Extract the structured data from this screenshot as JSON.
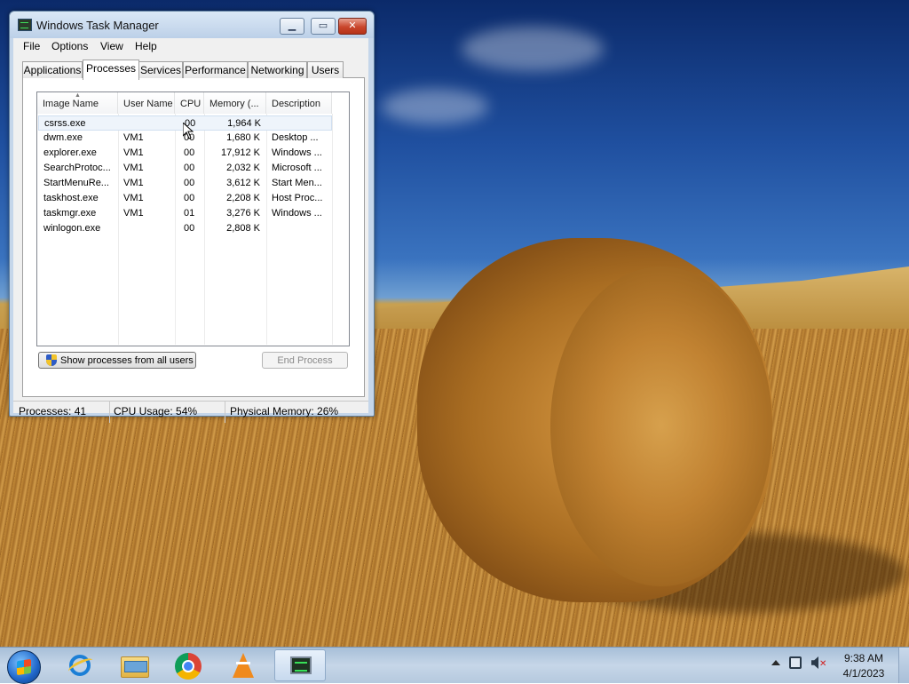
{
  "window": {
    "title": "Windows Task Manager",
    "menu": [
      "File",
      "Options",
      "View",
      "Help"
    ],
    "tabs": [
      "Applications",
      "Processes",
      "Services",
      "Performance",
      "Networking",
      "Users"
    ],
    "active_tab": "Processes"
  },
  "process_table": {
    "columns": [
      "Image Name",
      "User Name",
      "CPU",
      "Memory (...",
      "Description"
    ],
    "rows": [
      [
        "csrss.exe",
        "",
        "00",
        "1,964 K",
        ""
      ],
      [
        "dwm.exe",
        "VM1",
        "00",
        "1,680 K",
        "Desktop ..."
      ],
      [
        "explorer.exe",
        "VM1",
        "00",
        "17,912 K",
        "Windows ..."
      ],
      [
        "SearchProtoc...",
        "VM1",
        "00",
        "2,032 K",
        "Microsoft ..."
      ],
      [
        "StartMenuRe...",
        "VM1",
        "00",
        "3,612 K",
        "Start Men..."
      ],
      [
        "taskhost.exe",
        "VM1",
        "00",
        "2,208 K",
        "Host Proc..."
      ],
      [
        "taskmgr.exe",
        "VM1",
        "01",
        "3,276 K",
        "Windows ..."
      ],
      [
        "winlogon.exe",
        "",
        "00",
        "2,808 K",
        ""
      ]
    ]
  },
  "buttons": {
    "show_all": "Show processes from all users",
    "end_process": "End Process"
  },
  "status": {
    "processes": "Processes: 41",
    "cpu": "CPU Usage: 54%",
    "memory": "Physical Memory: 26%"
  },
  "taskbar": {
    "pinned": [
      "internet-explorer-icon",
      "file-explorer-icon",
      "chrome-icon",
      "vlc-icon",
      "task-manager-icon"
    ],
    "clock_time": "9:38 AM",
    "clock_date": "4/1/2023"
  }
}
